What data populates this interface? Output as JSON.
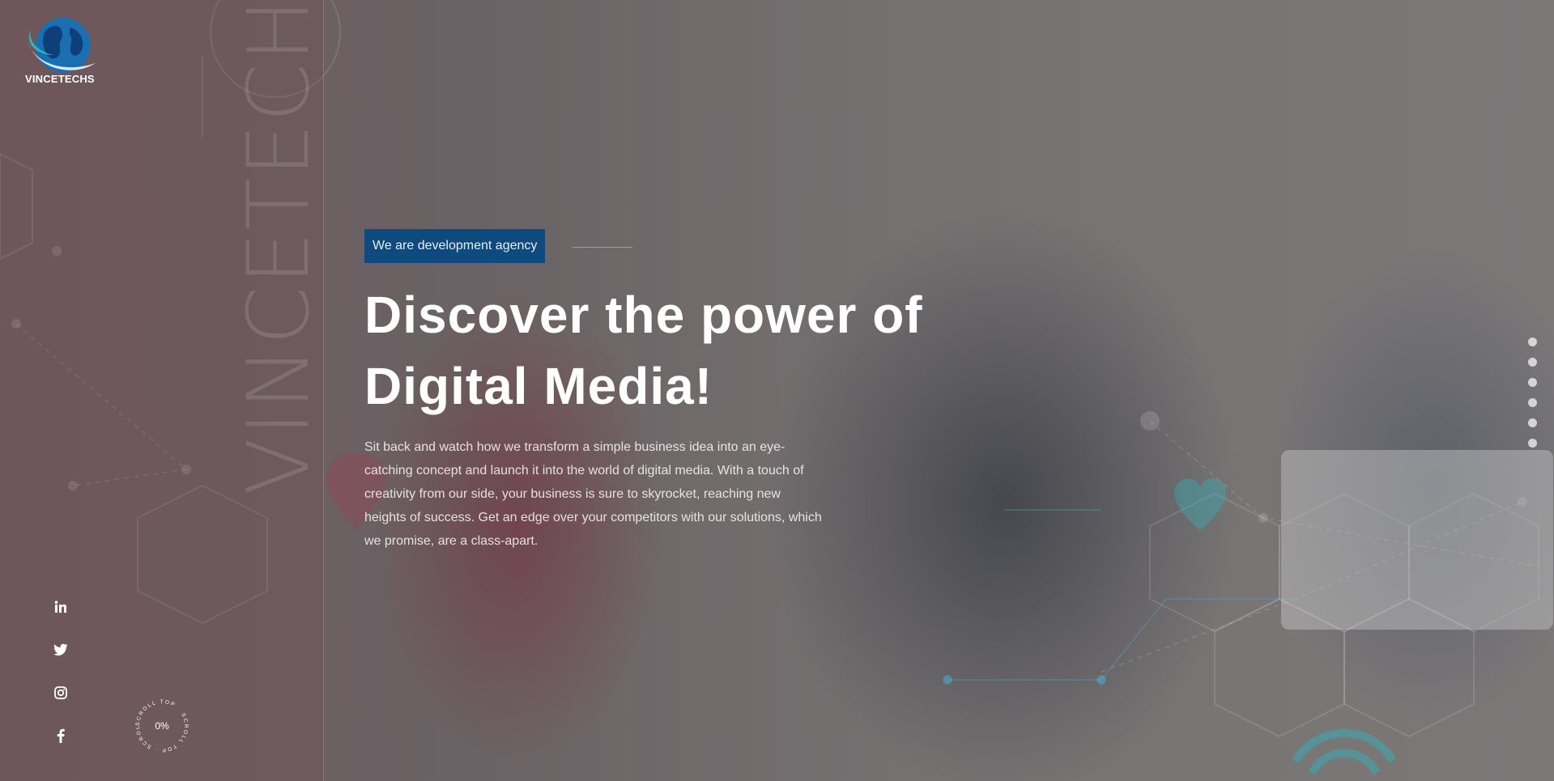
{
  "brand": {
    "logo_text": "VINCETECHS",
    "vertical_text": "VINCETECHS"
  },
  "hero": {
    "tag": "We are development agency",
    "title_line1": "Discover the power of",
    "title_line2": "Digital Media!",
    "description": "Sit back and watch how we transform a simple business idea into an eye-catching concept and launch it into the world of digital media. With a touch of creativity from our side, your business is sure to skyrocket, reaching new heights of success. Get an edge over your competitors with our solutions, which we promise, are a class-apart."
  },
  "social": [
    "linkedin-icon",
    "twitter-icon",
    "instagram-icon",
    "facebook-icon"
  ],
  "scroll_top": {
    "label": "SCROLL TOP",
    "progress": "0%"
  },
  "slider": {
    "dot_count": 6
  },
  "colors": {
    "badge": "#0e4a7d",
    "logo_blue": "#1a6fb3",
    "accent_cyan": "#2ab9c4"
  }
}
